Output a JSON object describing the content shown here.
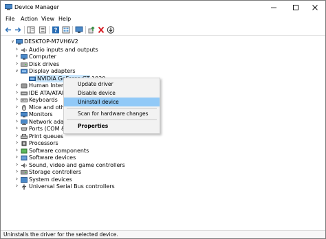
{
  "window": {
    "title": "Device Manager"
  },
  "menu": [
    "File",
    "Action",
    "View",
    "Help"
  ],
  "toolbar": {
    "icons": [
      "back-arrow-icon",
      "forward-arrow-icon",
      "properties-panel-icon",
      "show-hidden-icon",
      "help-icon",
      "view-list-icon",
      "monitor-icon",
      "update-driver-icon",
      "uninstall-icon",
      "download-icon"
    ]
  },
  "tree": {
    "root": "DESKTOP-M7VH6V2",
    "items": [
      {
        "label": "Audio inputs and outputs",
        "icon": "speaker-icon",
        "expander": ">"
      },
      {
        "label": "Computer",
        "icon": "computer-icon",
        "expander": ">"
      },
      {
        "label": "Disk drives",
        "icon": "disk-icon",
        "expander": ">"
      },
      {
        "label": "Display adapters",
        "icon": "display-adapter-icon",
        "expander": "v"
      },
      {
        "label": "NVIDIA GeForce GT 1030",
        "icon": "display-adapter-icon",
        "expander": ""
      },
      {
        "label": "Human Interface",
        "icon": "hid-icon",
        "expander": ">"
      },
      {
        "label": "IDE ATA/ATAPI c",
        "icon": "ide-icon",
        "expander": ">"
      },
      {
        "label": "Keyboards",
        "icon": "keyboard-icon",
        "expander": ">"
      },
      {
        "label": "Mice and other",
        "icon": "mouse-icon",
        "expander": ">"
      },
      {
        "label": "Monitors",
        "icon": "monitor-icon",
        "expander": ">"
      },
      {
        "label": "Network adapte",
        "icon": "network-icon",
        "expander": ">"
      },
      {
        "label": "Ports (COM & L",
        "icon": "port-icon",
        "expander": ">"
      },
      {
        "label": "Print queues",
        "icon": "printer-icon",
        "expander": ">"
      },
      {
        "label": "Processors",
        "icon": "processor-icon",
        "expander": ">"
      },
      {
        "label": "Software components",
        "icon": "software-component-icon",
        "expander": ">"
      },
      {
        "label": "Software devices",
        "icon": "software-device-icon",
        "expander": ">"
      },
      {
        "label": "Sound, video and game controllers",
        "icon": "sound-icon",
        "expander": ">"
      },
      {
        "label": "Storage controllers",
        "icon": "storage-icon",
        "expander": ">"
      },
      {
        "label": "System devices",
        "icon": "system-icon",
        "expander": ">"
      },
      {
        "label": "Universal Serial Bus controllers",
        "icon": "usb-icon",
        "expander": ">"
      }
    ]
  },
  "context_menu": {
    "items": [
      "Update driver",
      "Disable device",
      "Uninstall device",
      "Scan for hardware changes",
      "Properties"
    ],
    "highlighted": "Uninstall device"
  },
  "status": {
    "text": "Uninstalls the driver for the selected device."
  },
  "colors": {
    "selection": "#cce8ff",
    "menu_bg": "#f2f2f2",
    "menu_highlight": "#91c9f7",
    "icon_blue": "#2b6fb6",
    "uninstall_red": "#d81f26",
    "update_green": "#2e8b3a"
  }
}
